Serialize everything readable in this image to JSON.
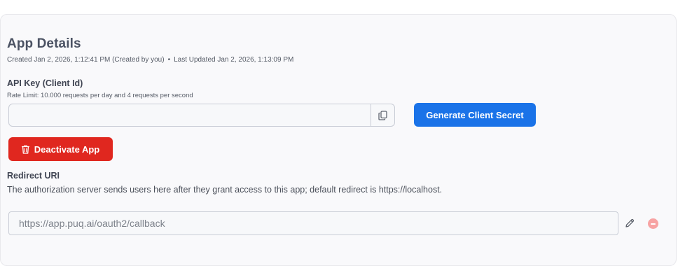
{
  "app_details": {
    "title": "App Details",
    "created": "Created Jan 2, 2026, 1:12:41 PM (Created by you)",
    "separator": "•",
    "updated": "Last Updated Jan 2, 2026, 1:13:09 PM"
  },
  "api_key": {
    "label": "API Key (Client Id)",
    "rate_limit": "Rate Limit: 10.000 requests per day and 4 requests per second",
    "value": "",
    "copy_icon": "copy-icon",
    "generate_button": "Generate Client Secret"
  },
  "deactivate": {
    "icon": "trash-icon",
    "label": "Deactivate App"
  },
  "redirect": {
    "label": "Redirect URI",
    "description": "The authorization server sends users here after they grant access to this app; default redirect is https://localhost.",
    "uri_placeholder": "https://app.puq.ai/oauth2/callback",
    "edit_icon": "pencil-icon",
    "remove_icon": "remove-circle-icon"
  },
  "colors": {
    "primary": "#1a73e8",
    "danger": "#e0271f",
    "remove_muted": "#f7a3a3"
  }
}
